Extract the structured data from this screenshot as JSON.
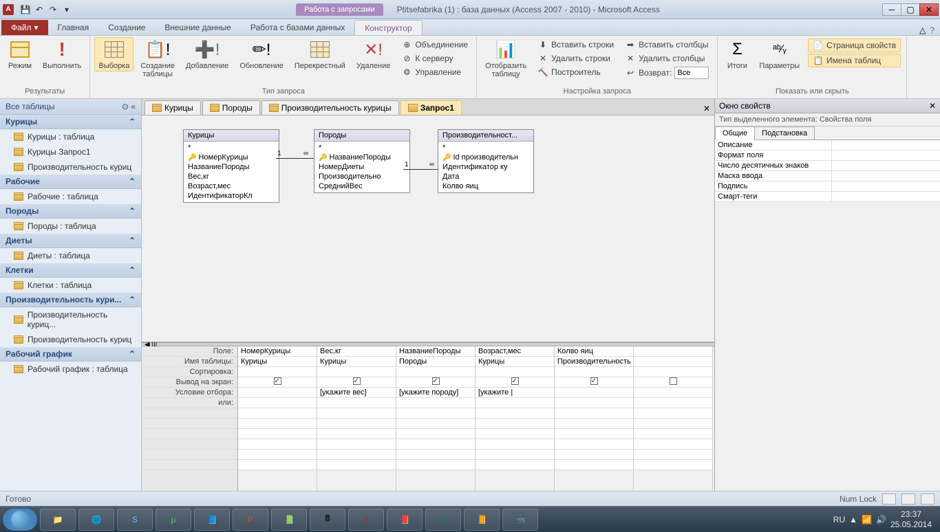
{
  "titlebar": {
    "context_tab": "Работа с запросами",
    "title": "Ptitsefabrika (1) : база данных (Access 2007 - 2010)  -  Microsoft Access"
  },
  "ribbon_tabs": {
    "file": "Файл",
    "tabs": [
      "Главная",
      "Создание",
      "Внешние данные",
      "Работа с базами данных",
      "Конструктор"
    ],
    "active_index": 4
  },
  "ribbon": {
    "groups": {
      "results": {
        "label": "Результаты",
        "mode": "Режим",
        "run": "Выполнить"
      },
      "query_type": {
        "label": "Тип запроса",
        "select": "Выборка",
        "make_table": "Создание\nтаблицы",
        "append": "Добавление",
        "update": "Обновление",
        "crosstab": "Перекрестный",
        "delete": "Удаление",
        "union": "Объединение",
        "passthrough": "К серверу",
        "datadef": "Управление"
      },
      "setup": {
        "label": "Настройка запроса",
        "show_table": "Отобразить\nтаблицу",
        "insert_rows": "Вставить строки",
        "delete_rows": "Удалить строки",
        "builder": "Построитель",
        "insert_cols": "Вставить столбцы",
        "delete_cols": "Удалить столбцы",
        "return": "Возврат:",
        "return_val": "Все"
      },
      "show_hide": {
        "label": "Показать или скрыть",
        "totals": "Итоги",
        "params": "Параметры",
        "prop_sheet": "Страница свойств",
        "table_names": "Имена таблиц"
      }
    }
  },
  "nav": {
    "header": "Все таблицы",
    "sections": [
      {
        "title": "Курицы",
        "items": [
          "Курицы : таблица",
          "Курицы Запрос1",
          "Производительность куриц"
        ]
      },
      {
        "title": "Рабочие",
        "items": [
          "Рабочие : таблица"
        ]
      },
      {
        "title": "Породы",
        "items": [
          "Породы : таблица"
        ]
      },
      {
        "title": "Диеты",
        "items": [
          "Диеты : таблица"
        ]
      },
      {
        "title": "Клетки",
        "items": [
          "Клетки : таблица"
        ]
      },
      {
        "title": "Производительность кури...",
        "items": [
          "Производительность куриц...",
          "Производительность куриц"
        ]
      },
      {
        "title": "Рабочий график",
        "items": [
          "Рабочий график : таблица"
        ]
      }
    ]
  },
  "doc_tabs": [
    "Курицы",
    "Породы",
    "Производительность курицы",
    "Запрос1"
  ],
  "doc_active": 3,
  "tables": {
    "t1": {
      "title": "Курицы",
      "fields": [
        "*",
        "НомерКурицы",
        "НазваниеПороды",
        "Вес,кг",
        "Возраст,мес",
        "ИдентификаторКл"
      ],
      "key_index": 1
    },
    "t2": {
      "title": "Породы",
      "fields": [
        "*",
        "НазваниеПороды",
        "НомерДиеты",
        "Производительно",
        "СреднийВес"
      ],
      "key_index": 1
    },
    "t3": {
      "title": "Производительност...",
      "fields": [
        "*",
        "Id производительн",
        "Идентификатор ку",
        "Дата",
        "Колво яиц"
      ],
      "key_index": 1
    }
  },
  "grid": {
    "labels": [
      "Поле:",
      "Имя таблицы:",
      "Сортировка:",
      "Вывод на экран:",
      "Условие отбора:",
      "или:"
    ],
    "cols": [
      {
        "field": "НомерКурицы",
        "table": "Курицы",
        "sort": "",
        "show": true,
        "criteria": "",
        "or": ""
      },
      {
        "field": "Вес,кг",
        "table": "Курицы",
        "sort": "",
        "show": true,
        "criteria": "[укажите вес]",
        "or": ""
      },
      {
        "field": "НазваниеПороды",
        "table": "Породы",
        "sort": "",
        "show": true,
        "criteria": "[укажите породу]",
        "or": ""
      },
      {
        "field": "Возраст,мес",
        "table": "Курицы",
        "sort": "",
        "show": true,
        "criteria": "[укажите |",
        "or": ""
      },
      {
        "field": "Колво яиц",
        "table": "Производительность",
        "sort": "",
        "show": true,
        "criteria": "",
        "or": ""
      },
      {
        "field": "",
        "table": "",
        "sort": "",
        "show": false,
        "criteria": "",
        "or": ""
      }
    ]
  },
  "props": {
    "title": "Окно свойств",
    "subtitle": "Тип выделенного элемента:  Свойства поля",
    "tabs": [
      "Общие",
      "Подстановка"
    ],
    "rows": [
      "Описание",
      "Формат поля",
      "Число десятичных знаков",
      "Маска ввода",
      "Подпись",
      "Смарт-теги"
    ]
  },
  "status": {
    "ready": "Готово",
    "numlock": "Num Lock"
  },
  "tray": {
    "lang": "RU",
    "time": "23:37",
    "date": "25.05.2014"
  }
}
